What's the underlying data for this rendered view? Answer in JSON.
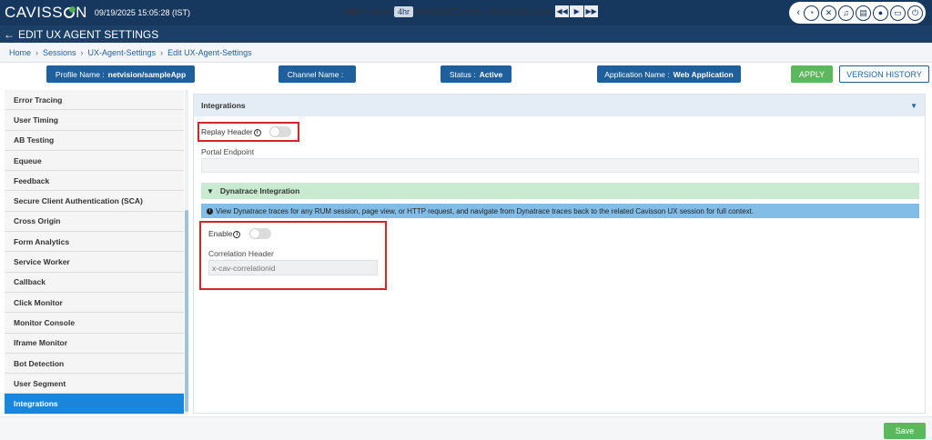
{
  "topbar": {
    "logo_prefix": "CAVISS",
    "logo_suffix": "N",
    "datetime": "09/19/2025 15:05:28 (IST)",
    "time_range_label": "Past 4 Hours",
    "time_badge": "4hr",
    "time_range": "09/19/2025 10:49  -  09/19/2025 14:49",
    "icons": [
      "chevron-left-icon",
      "history-icon",
      "wrench-cross-icon",
      "bell-icon",
      "save-icon",
      "user-icon",
      "chat-icon",
      "power-icon"
    ]
  },
  "titlebar": {
    "title": "EDIT UX AGENT SETTINGS"
  },
  "breadcrumb": [
    "Home",
    "Sessions",
    "UX-Agent-Settings",
    "Edit UX-Agent-Settings"
  ],
  "info": {
    "profile_label": "Profile Name :",
    "profile_value": "netvision/sampleApp",
    "channel_label": "Channel Name :",
    "channel_value": "",
    "status_label": "Status :",
    "status_value": "Active",
    "app_label": "Application Name :",
    "app_value": "Web Application",
    "apply": "APPLY",
    "version_history": "VERSION HISTORY"
  },
  "sidebar": {
    "items": [
      "Error Tracing",
      "User Timing",
      "AB Testing",
      "Equeue",
      "Feedback",
      "Secure Client Authentication (SCA)",
      "Cross Origin",
      "Form Analytics",
      "Service Worker",
      "Callback",
      "Click Monitor",
      "Monitor Console",
      "Iframe Monitor",
      "Bot Detection",
      "User Segment",
      "Integrations"
    ],
    "active_index": 15
  },
  "panel": {
    "title": "Integrations",
    "replay_header_label": "Replay Header",
    "replay_header_enabled": false,
    "portal_endpoint_label": "Portal Endpoint",
    "portal_endpoint_value": "",
    "dynatrace_title": "Dynatrace Integration",
    "dynatrace_note": "View Dynatrace traces for any RUM session, page view, or HTTP request, and navigate from Dynatrace traces back to the related Cavisson UX session for full context.",
    "enable_label": "Enable",
    "enable_enabled": false,
    "correlation_header_label": "Correlation Header",
    "correlation_header_placeholder": "x-cav-correlationid"
  },
  "footer": {
    "save": "Save"
  },
  "colors": {
    "navy": "#16375e",
    "accent": "#1f5f9c",
    "active": "#1b85d9",
    "green": "#5cb85c",
    "highlight": "#d2262b"
  }
}
